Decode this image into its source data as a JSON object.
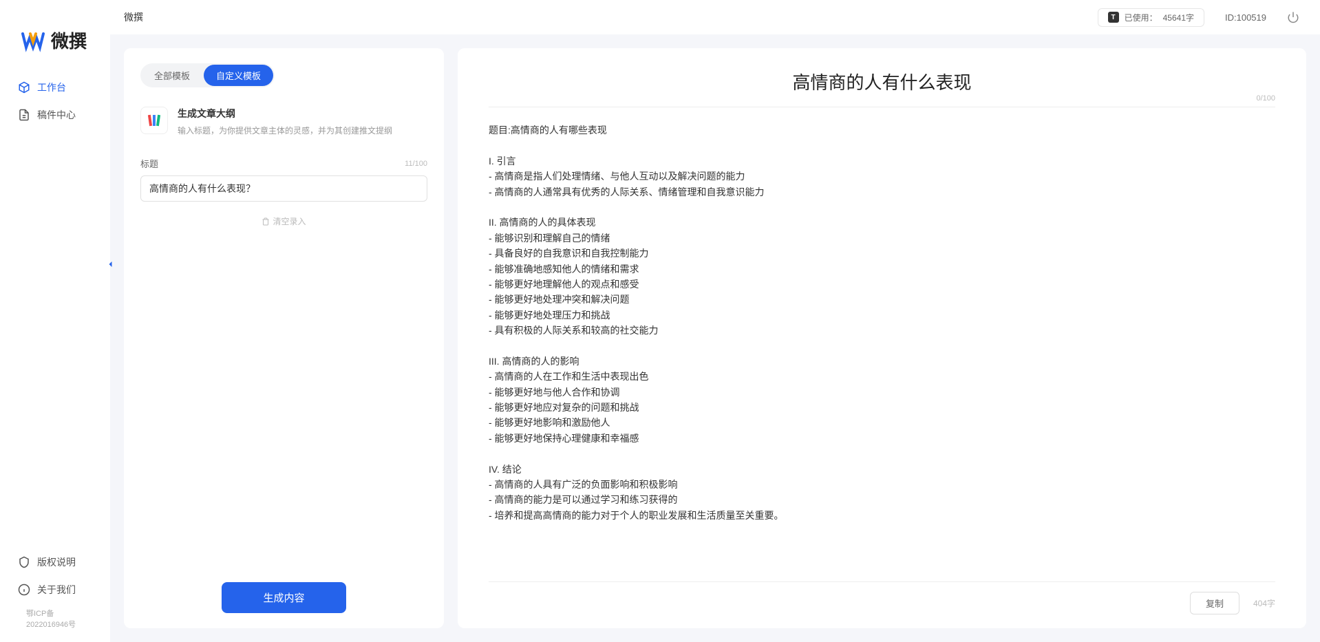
{
  "app": {
    "name": "微撰",
    "logo_text": "微撰"
  },
  "topbar": {
    "title": "微撰",
    "usage_label": "已使用：",
    "usage_value": "45641字",
    "user_id": "ID:100519"
  },
  "sidebar": {
    "nav": [
      {
        "label": "工作台",
        "active": true
      },
      {
        "label": "稿件中心",
        "active": false
      }
    ],
    "bottom": [
      {
        "label": "版权说明"
      },
      {
        "label": "关于我们"
      }
    ],
    "icp": "鄂ICP备2022016946号"
  },
  "left_panel": {
    "tabs": [
      {
        "label": "全部模板",
        "active": false
      },
      {
        "label": "自定义模板",
        "active": true
      }
    ],
    "template": {
      "title": "生成文章大纲",
      "desc": "输入标题，为你提供文章主体的灵感，并为其创建推文提纲"
    },
    "input": {
      "label": "标题",
      "counter": "11/100",
      "value": "高情商的人有什么表现？"
    },
    "clear_label": "清空录入",
    "generate_label": "生成内容"
  },
  "output": {
    "title": "高情商的人有什么表现",
    "header_counter": "0/100",
    "body": "题目:高情商的人有哪些表现\n\nI. 引言\n- 高情商是指人们处理情绪、与他人互动以及解决问题的能力\n- 高情商的人通常具有优秀的人际关系、情绪管理和自我意识能力\n\nII. 高情商的人的具体表现\n- 能够识别和理解自己的情绪\n- 具备良好的自我意识和自我控制能力\n- 能够准确地感知他人的情绪和需求\n- 能够更好地理解他人的观点和感受\n- 能够更好地处理冲突和解决问题\n- 能够更好地处理压力和挑战\n- 具有积极的人际关系和较高的社交能力\n\nIII. 高情商的人的影响\n- 高情商的人在工作和生活中表现出色\n- 能够更好地与他人合作和协调\n- 能够更好地应对复杂的问题和挑战\n- 能够更好地影响和激励他人\n- 能够更好地保持心理健康和幸福感\n\nIV. 结论\n- 高情商的人具有广泛的负面影响和积极影响\n- 高情商的能力是可以通过学习和练习获得的\n- 培养和提高高情商的能力对于个人的职业发展和生活质量至关重要。",
    "copy_label": "复制",
    "word_count": "404字"
  }
}
